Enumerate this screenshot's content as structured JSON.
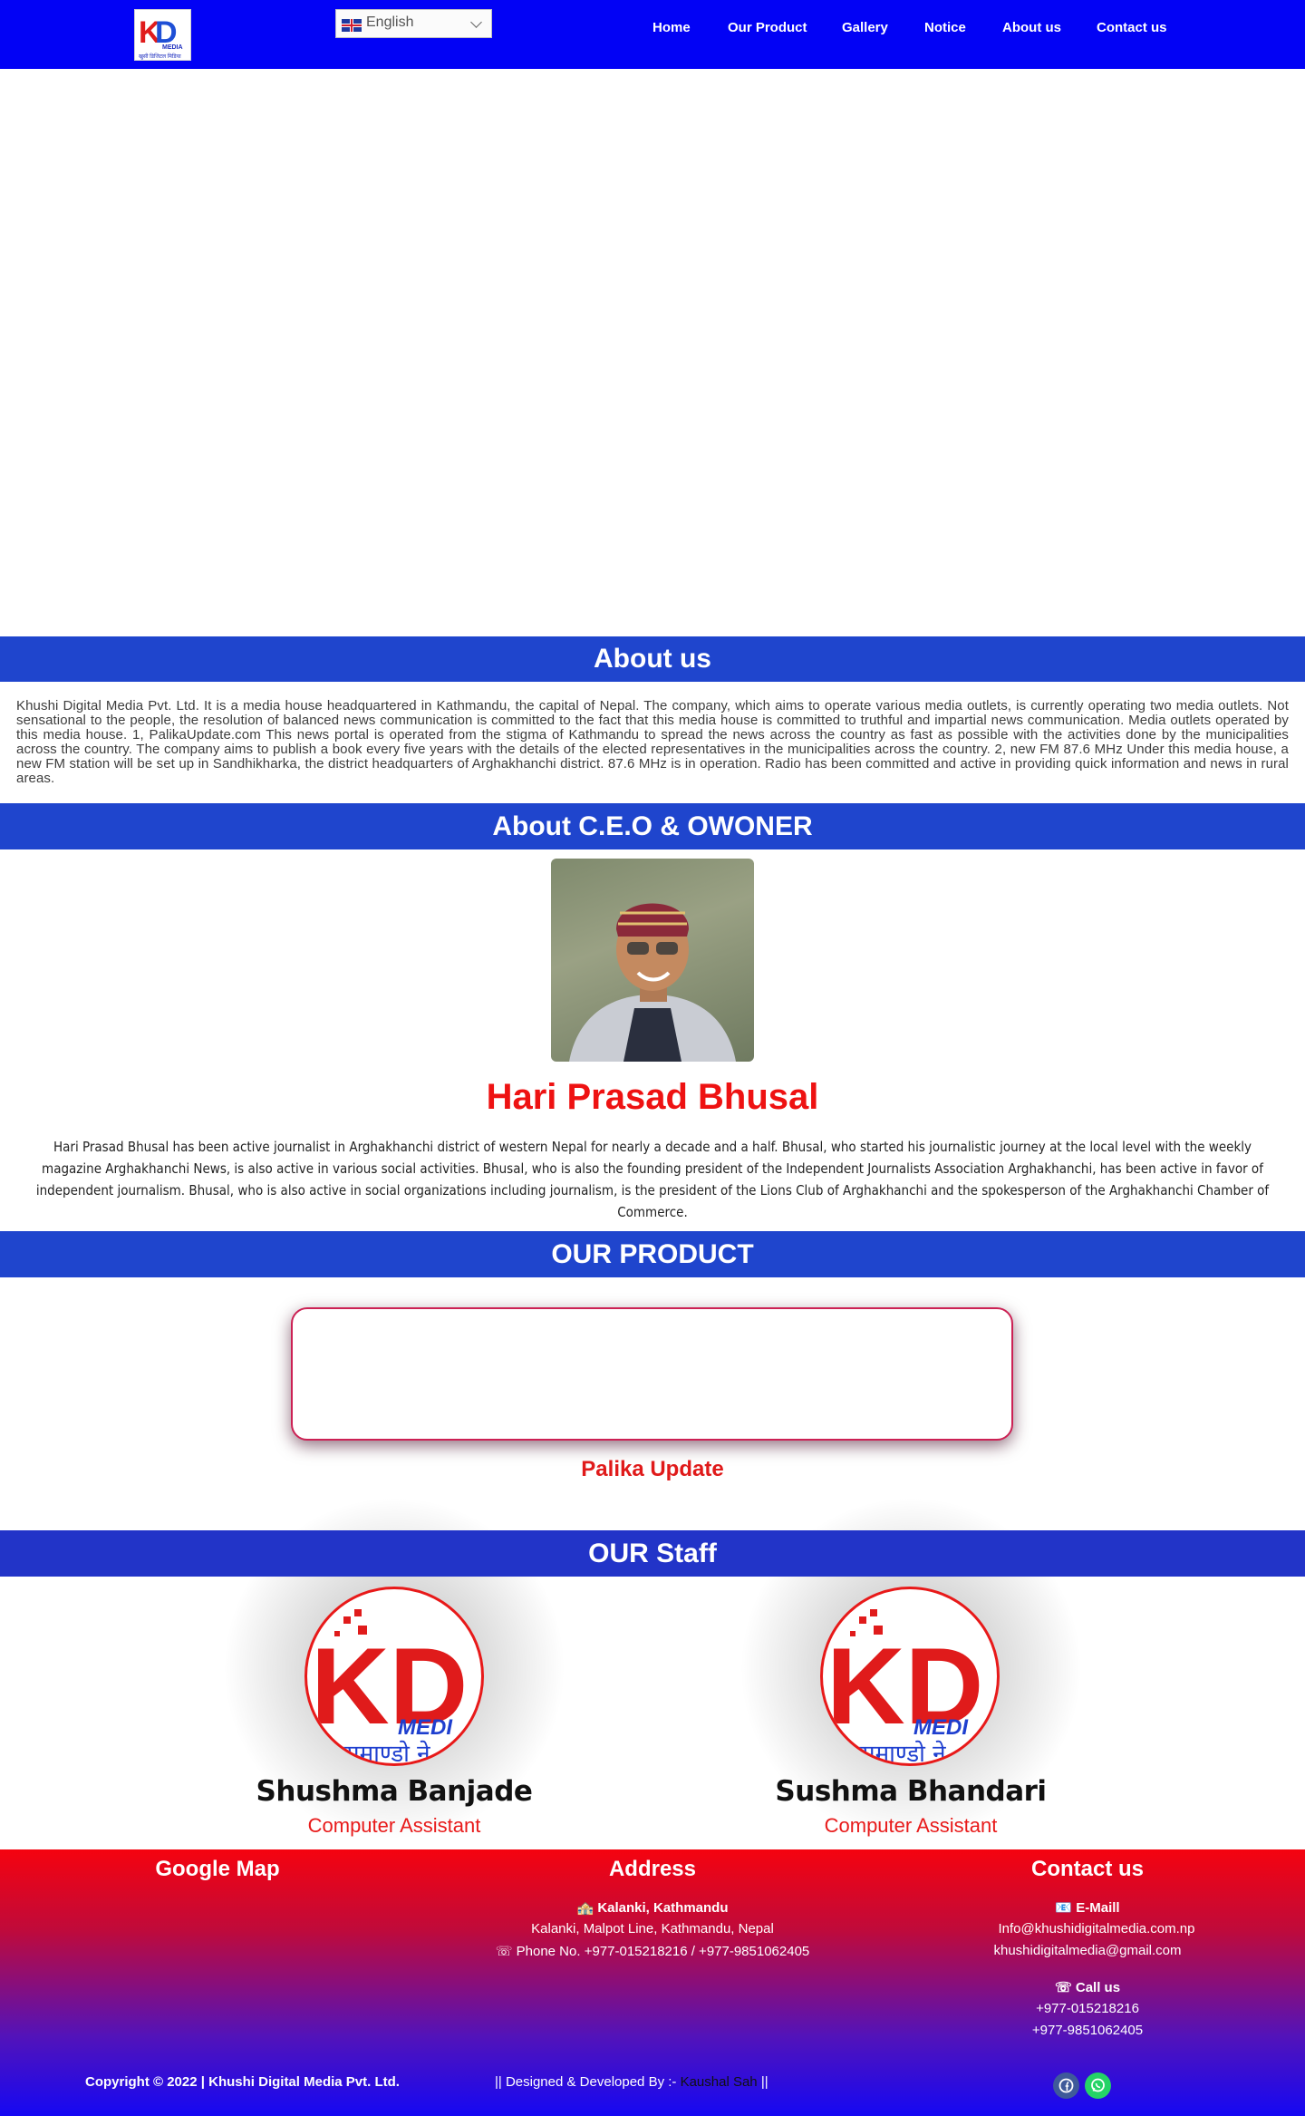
{
  "nav": {
    "language": "English",
    "items": [
      "Home",
      "Our Product",
      "Gallery",
      "Notice",
      "About us",
      "Contact us"
    ]
  },
  "logo": {
    "letters_k": "K",
    "letters_d": "D",
    "media": "MEDIA",
    "tagline": "खुसी डिजिटल मिडिया"
  },
  "about": {
    "heading": "About us",
    "text": "Khushi Digital Media Pvt. Ltd. It is a media house headquartered in Kathmandu, the capital of Nepal. The company, which aims to operate various media outlets, is currently operating two media outlets. Not sensational to the people, the resolution of balanced news communication is committed to the fact that this media house is committed to truthful and impartial news communication. Media outlets operated by this media house. 1, PalikaUpdate.com This news portal is operated from the stigma of Kathmandu to spread the news across the country as fast as possible with the activities done by the municipalities across the country. The company aims to publish a book every five years with the details of the elected representatives in the municipalities across the country. 2, new FM 87.6 MHz Under this media house, a new FM station will be set up in Sandhikharka, the district headquarters of Arghakhanchi district. 87.6 MHz is in operation. Radio has been committed and active in providing quick information and news in rural areas."
  },
  "ceo": {
    "heading": "About C.E.O & OWONER",
    "name": "Hari Prasad Bhusal",
    "bio": "Hari Prasad Bhusal has been active journalist in Arghakhanchi district of western Nepal for nearly a decade and a half. Bhusal, who started his journalistic journey at the local level with the weekly magazine Arghakhanchi News, is also active in various social activities. Bhusal, who is also the founding president of the Independent Journalists Association Arghakhanchi, has been active in favor of independent journalism. Bhusal, who is also active in social organizations including journalism, is the president of the Lions Club of Arghakhanchi and the spokesperson of the Arghakhanchi Chamber of Commerce."
  },
  "product": {
    "heading": "OUR PRODUCT",
    "name": "Palika Update"
  },
  "staff": {
    "heading": "OUR Staff",
    "logo_text": "KD",
    "logo_media": "MEDI",
    "logo_nepali": "समाण्डो ने",
    "members": [
      {
        "name": "Shushma Banjade",
        "role": "Computer Assistant"
      },
      {
        "name": "Sushma Bhandari",
        "role": "Computer Assistant"
      }
    ]
  },
  "footer": {
    "map_heading": "Google Map",
    "address_heading": "Address",
    "address_title": "🏤 Kalanki, Kathmandu",
    "address_line": "Kalanki, Malpot Line, Kathmandu, Nepal",
    "phone_line": "☏ Phone No. +977-015218216 / +977-9851062405",
    "contact_heading": "Contact us",
    "email_title": "📧 E-Maill",
    "email_1": "Info@khushidigitalmedia.com.np",
    "email_2": "khushidigitalmedia@gmail.com",
    "call_title": "☏ Call us",
    "call_1": "+977-015218216",
    "call_2": "+977-9851062405",
    "copyright": "Copyright © 2022 | Khushi Digital Media Pvt. Ltd.",
    "designed_prefix": "|| Designed & Developed By :-",
    "designer": "Kaushal Sah",
    "designed_suffix": "||"
  },
  "colors": {
    "nav_bg": "#0202f5",
    "section_bar": "#1f45cd",
    "accent_red": "#ee1212",
    "facebook": "#3b5998",
    "whatsapp": "#25d366"
  },
  "icons": [
    "uk-flag-icon",
    "chevron-down-icon",
    "facebook-icon",
    "whatsapp-icon"
  ]
}
